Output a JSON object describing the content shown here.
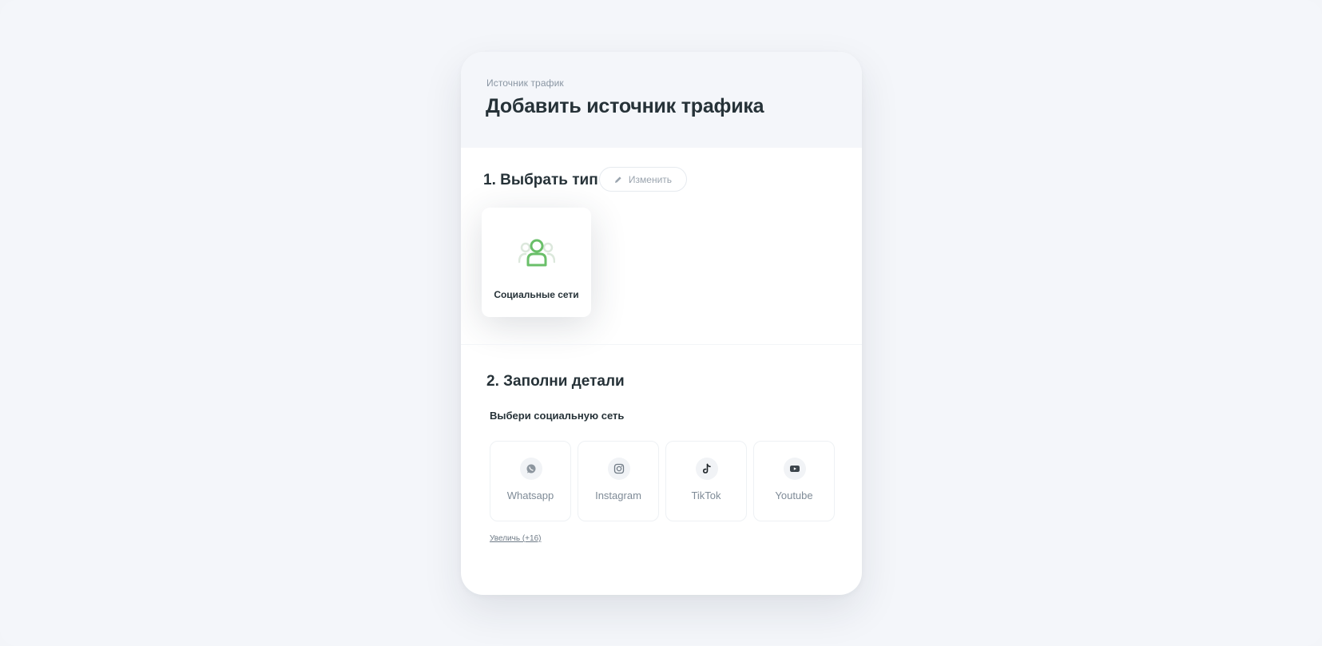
{
  "header": {
    "breadcrumb": "Источник трафик",
    "title": "Добавить источник трафика"
  },
  "step1": {
    "title": "1. Выбрать тип",
    "edit_label": "Изменить",
    "selected_type": {
      "label": "Социальные сети",
      "icon": "users-icon"
    }
  },
  "step2": {
    "title": "2. Заполни детали",
    "field_label": "Выбери социальную сеть",
    "networks": [
      {
        "label": "Whatsapp",
        "icon": "whatsapp-icon"
      },
      {
        "label": "Instagram",
        "icon": "instagram-icon"
      },
      {
        "label": "TikTok",
        "icon": "tiktok-icon"
      },
      {
        "label": "Youtube",
        "icon": "youtube-icon"
      }
    ],
    "more_label": "Увеличь (+16)"
  },
  "colors": {
    "accent_green": "#6abf69",
    "text_dark": "#263238",
    "text_muted": "#8a96a3",
    "background": "#f4f6fa"
  }
}
